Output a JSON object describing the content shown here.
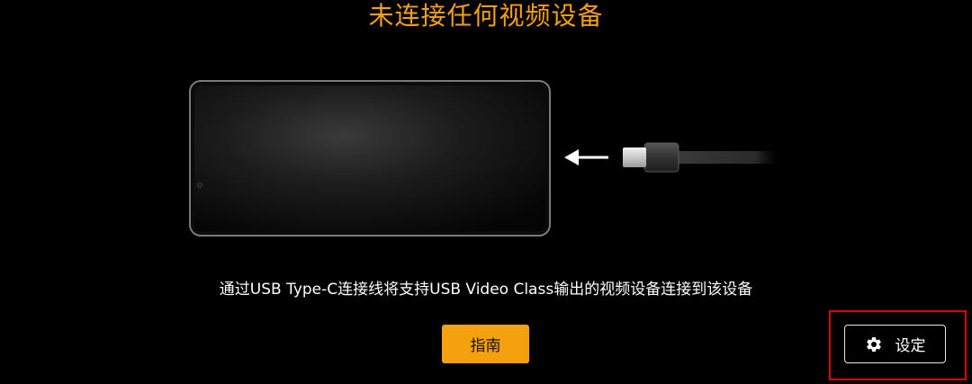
{
  "header": {
    "title": "未连接任何视频设备"
  },
  "illustration": {
    "phone_icon": "smartphone-landscape",
    "arrow_icon": "arrow-left",
    "cable_icon": "usb-type-c-cable"
  },
  "main": {
    "description": "通过USB Type-C连接线将支持USB Video Class输出的视频设备连接到该设备",
    "guide_label": "指南"
  },
  "settings": {
    "icon": "gear-icon",
    "label": "设定"
  },
  "colors": {
    "accent": "#f5a00f",
    "background": "#000000",
    "highlight": "#e00000"
  }
}
